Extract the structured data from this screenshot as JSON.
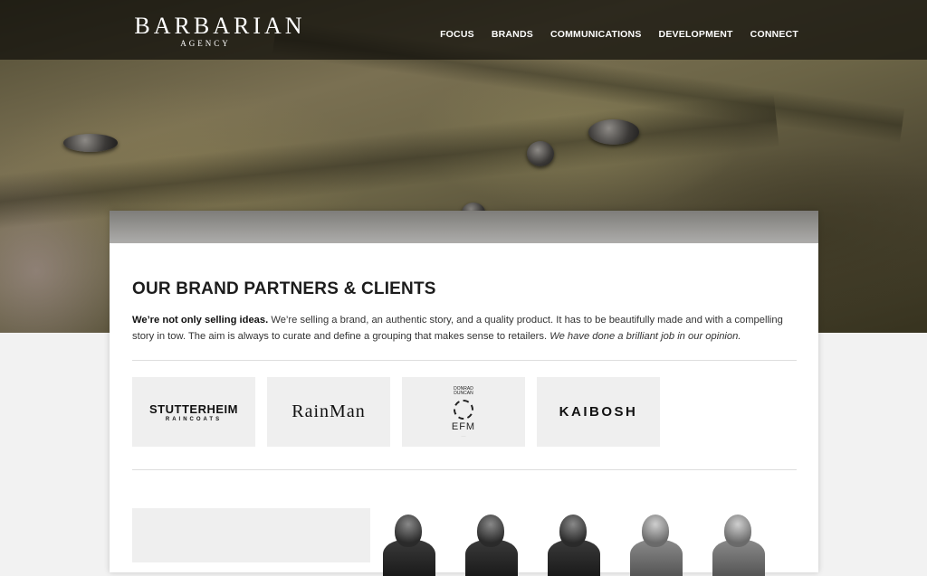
{
  "header": {
    "logo_main": "BARBARIAN",
    "logo_sub": "AGENCY",
    "nav": [
      {
        "label": "FOCUS"
      },
      {
        "label": "BRANDS"
      },
      {
        "label": "COMMUNICATIONS"
      },
      {
        "label": "DEVELOPMENT"
      },
      {
        "label": "CONNECT"
      }
    ]
  },
  "section": {
    "title": "OUR BRAND PARTNERS & CLIENTS",
    "intro_bold": "We’re not only selling ideas.",
    "intro_text": " We’re selling a brand, an authentic story, and a quality product. It has to be beautifully made and with a compelling story in tow. The aim is always to curate and define a grouping that makes sense to retailers. ",
    "intro_italic": "We have done a brilliant job in our opinion."
  },
  "brands": {
    "stutterheim": {
      "name": "STUTTERHEIM",
      "sub": "RAINCOATS"
    },
    "rainman": {
      "name": "RainMan"
    },
    "efm": {
      "top": "DONRAD DUNCAN",
      "name": "EFM"
    },
    "kaibosh": {
      "name": "KAIBOSH"
    }
  },
  "colors": {
    "page_bg": "#f2f2f2",
    "card_bg": "#ffffff",
    "tile_bg": "#efefef",
    "nav_text": "#ffffff"
  }
}
